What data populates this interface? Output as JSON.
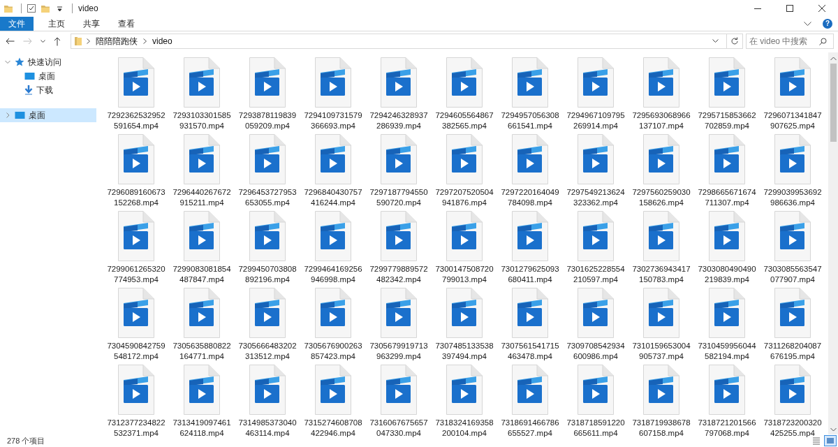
{
  "window": {
    "title": "video"
  },
  "ribbon_tabs": [
    {
      "label": "文件",
      "kind": "file"
    },
    {
      "label": "主页",
      "kind": "tab"
    },
    {
      "label": "共享",
      "kind": "tab"
    },
    {
      "label": "查看",
      "kind": "tab"
    }
  ],
  "help_button": {
    "label": "?"
  },
  "address_bar": {
    "path": [
      "陪陪陪跑侠",
      "video"
    ]
  },
  "search": {
    "placeholder": "在 video 中搜索"
  },
  "sidebar": {
    "items": [
      {
        "label": "快速访问",
        "kind": "quick-access",
        "expanded": true,
        "selected": false,
        "children": [
          {
            "label": "桌面",
            "kind": "desktop",
            "selected": false
          },
          {
            "label": "下载",
            "kind": "downloads",
            "selected": false
          }
        ]
      },
      {
        "label": "桌面",
        "kind": "desktop",
        "expanded": false,
        "selected": true
      }
    ]
  },
  "files": [
    {
      "name": "7292362532952591654.mp4"
    },
    {
      "name": "7293103301585931570.mp4"
    },
    {
      "name": "7293878119839059209.mp4"
    },
    {
      "name": "7294109731579366693.mp4"
    },
    {
      "name": "7294246328937286939.mp4"
    },
    {
      "name": "7294605564867382565.mp4"
    },
    {
      "name": "7294957056308661541.mp4"
    },
    {
      "name": "7294967109795269914.mp4"
    },
    {
      "name": "7295693068966137107.mp4"
    },
    {
      "name": "7295715853662702859.mp4"
    },
    {
      "name": "7296071341847907625.mp4"
    },
    {
      "name": "7296089160673152268.mp4"
    },
    {
      "name": "7296440267672915211.mp4"
    },
    {
      "name": "7296453727953653055.mp4"
    },
    {
      "name": "7296840430757416244.mp4"
    },
    {
      "name": "7297187794550590720.mp4"
    },
    {
      "name": "7297207520504941876.mp4"
    },
    {
      "name": "7297220164049784098.mp4"
    },
    {
      "name": "7297549213624323362.mp4"
    },
    {
      "name": "7297560259030158626.mp4"
    },
    {
      "name": "7298665671674711307.mp4"
    },
    {
      "name": "7299039953692986636.mp4"
    },
    {
      "name": "7299061265320774953.mp4"
    },
    {
      "name": "7299083081854487847.mp4"
    },
    {
      "name": "7299450703808892196.mp4"
    },
    {
      "name": "7299464169256946998.mp4"
    },
    {
      "name": "7299779889572482342.mp4"
    },
    {
      "name": "7300147508720799013.mp4"
    },
    {
      "name": "7301279625093680411.mp4"
    },
    {
      "name": "7301625228554210597.mp4"
    },
    {
      "name": "7302736943417150783.mp4"
    },
    {
      "name": "7303080490490219839.mp4"
    },
    {
      "name": "7303085563547077907.mp4"
    },
    {
      "name": "7304590842759548172.mp4"
    },
    {
      "name": "7305635880822164771.mp4"
    },
    {
      "name": "7305666483202313512.mp4"
    },
    {
      "name": "7305676900263857423.mp4"
    },
    {
      "name": "7305679919713963299.mp4"
    },
    {
      "name": "7307485133538397494.mp4"
    },
    {
      "name": "7307561541715463478.mp4"
    },
    {
      "name": "7309708542934600986.mp4"
    },
    {
      "name": "7310159653004905737.mp4"
    },
    {
      "name": "7310459956044582194.mp4"
    },
    {
      "name": "7311268204087676195.mp4"
    },
    {
      "name": "7312377234822532371.mp4"
    },
    {
      "name": "7313419097461624118.mp4"
    },
    {
      "name": "7314985373040463114.mp4"
    },
    {
      "name": "7315274608708422946.mp4"
    },
    {
      "name": "7316067675657047330.mp4"
    },
    {
      "name": "7318324169358200104.mp4"
    },
    {
      "name": "7318691466786655527.mp4"
    },
    {
      "name": "7318718591220665611.mp4"
    },
    {
      "name": "7318719938678607158.mp4"
    },
    {
      "name": "7318721201566797068.mp4"
    },
    {
      "name": "7318723200320425255.mp4"
    }
  ],
  "status_bar": {
    "item_count": "278 个项目"
  },
  "view_buttons": [
    {
      "kind": "details",
      "selected": false
    },
    {
      "kind": "large-icons",
      "selected": true
    }
  ]
}
